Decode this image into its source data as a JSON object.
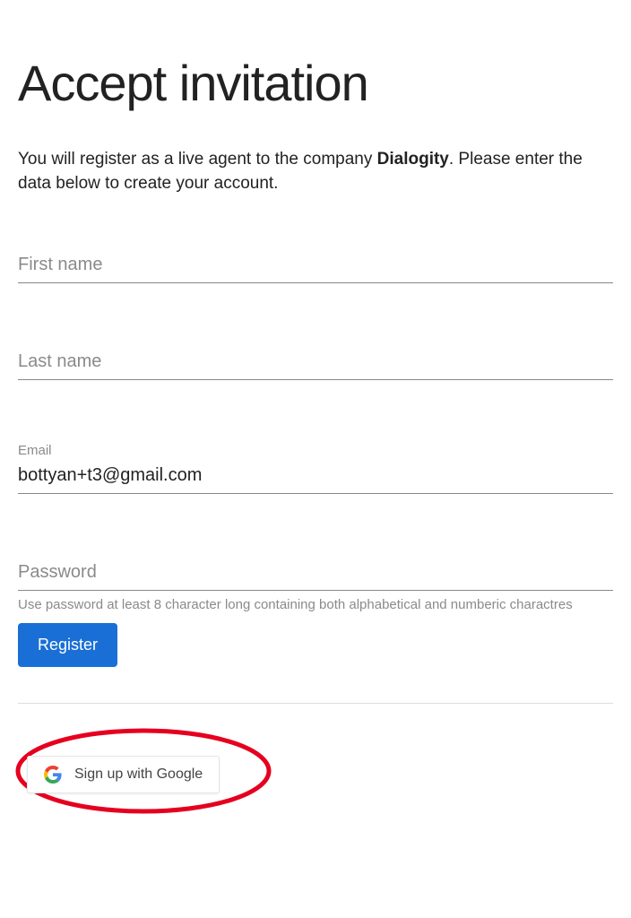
{
  "title": "Accept invitation",
  "description": {
    "prefix": "You will register as a live agent to the company ",
    "company": "Dialogity",
    "suffix": ". Please enter the data below to create your account."
  },
  "fields": {
    "firstName": {
      "label": "First name",
      "value": ""
    },
    "lastName": {
      "label": "Last name",
      "value": ""
    },
    "email": {
      "label": "Email",
      "value": "bottyan+t3@gmail.com"
    },
    "password": {
      "label": "Password",
      "value": "",
      "hint": "Use password at least 8 character long containing both alphabetical and numberic charactres"
    }
  },
  "buttons": {
    "register": "Register",
    "google": "Sign up with Google"
  }
}
